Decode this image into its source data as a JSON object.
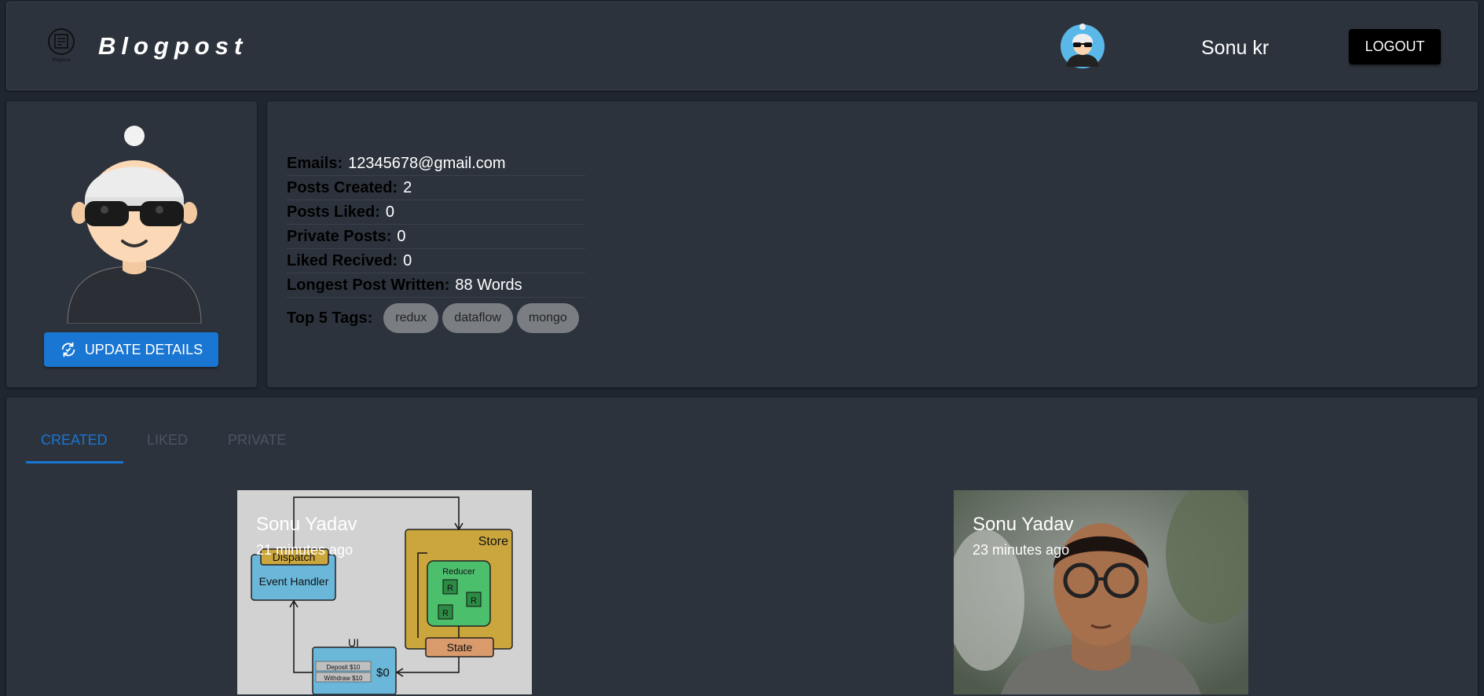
{
  "app": {
    "brand": "Blogpost",
    "logo_caption": "Blogpost"
  },
  "header": {
    "username": "Sonu kr",
    "logout_label": "LOGOUT"
  },
  "profile": {
    "update_label": "UPDATE DETAILS"
  },
  "stats": {
    "email_label": "Emails:",
    "email_value": "12345678@gmail.com",
    "created_label": "Posts Created:",
    "created_value": "2",
    "liked_label": "Posts Liked:",
    "liked_value": "0",
    "private_label": "Private Posts:",
    "private_value": "0",
    "received_label": "Liked Recived:",
    "received_value": "0",
    "longest_label": "Longest Post Written:",
    "longest_value": "88 Words",
    "tags_label": "Top 5 Tags:",
    "tags": [
      "redux",
      "dataflow",
      "mongo"
    ]
  },
  "tabs": [
    {
      "label": "CREATED",
      "active": true
    },
    {
      "label": "LIKED",
      "active": false
    },
    {
      "label": "PRIVATE",
      "active": false
    }
  ],
  "posts": [
    {
      "author": "Sonu Yadav",
      "time": "21 minutes ago",
      "diagram": {
        "dispatch": "Dispatch",
        "event_handler": "Event Handler",
        "store": "Store",
        "reducer": "Reducer",
        "r": "R",
        "state": "State",
        "ui": "UI",
        "deposit": "Deposit $10",
        "withdraw": "Withdraw $10",
        "balance": "$0"
      }
    },
    {
      "author": "Sonu Yadav",
      "time": "23 minutes ago"
    }
  ]
}
